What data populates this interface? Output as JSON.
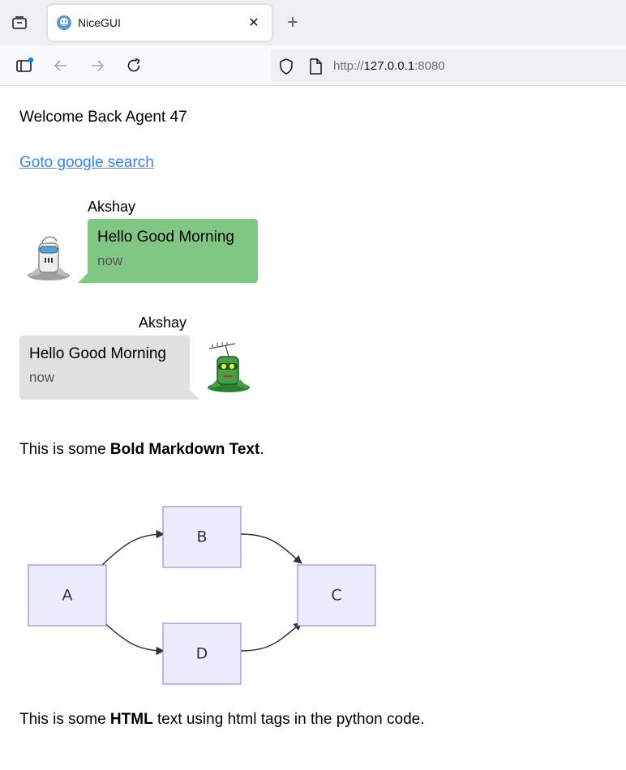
{
  "browser": {
    "tab_title": "NiceGUI",
    "url_prefix": "http://",
    "url_host": "127.0.0.1",
    "url_port": ":8080"
  },
  "page": {
    "welcome": "Welcome Back Agent 47",
    "link_text": "Goto google search",
    "chat": [
      {
        "name": "Akshay",
        "text": "Hello Good Morning",
        "stamp": "now",
        "sent": true
      },
      {
        "name": "Akshay",
        "text": "Hello Good Morning",
        "stamp": "now",
        "sent": false
      }
    ],
    "markdown": {
      "before": "This is some ",
      "bold": "Bold Markdown Text",
      "after": "."
    },
    "html_text": {
      "before": "This is some ",
      "bold": "HTML",
      "after": " text using html tags in the python code."
    },
    "mermaid": {
      "nodes": [
        "A",
        "B",
        "C",
        "D"
      ],
      "node_fill": "#ececff",
      "node_stroke": "#9370db"
    }
  },
  "colors": {
    "link": "#3b82f6",
    "sent_bubble": "#81c784",
    "received_bubble": "#e0e0e0"
  }
}
